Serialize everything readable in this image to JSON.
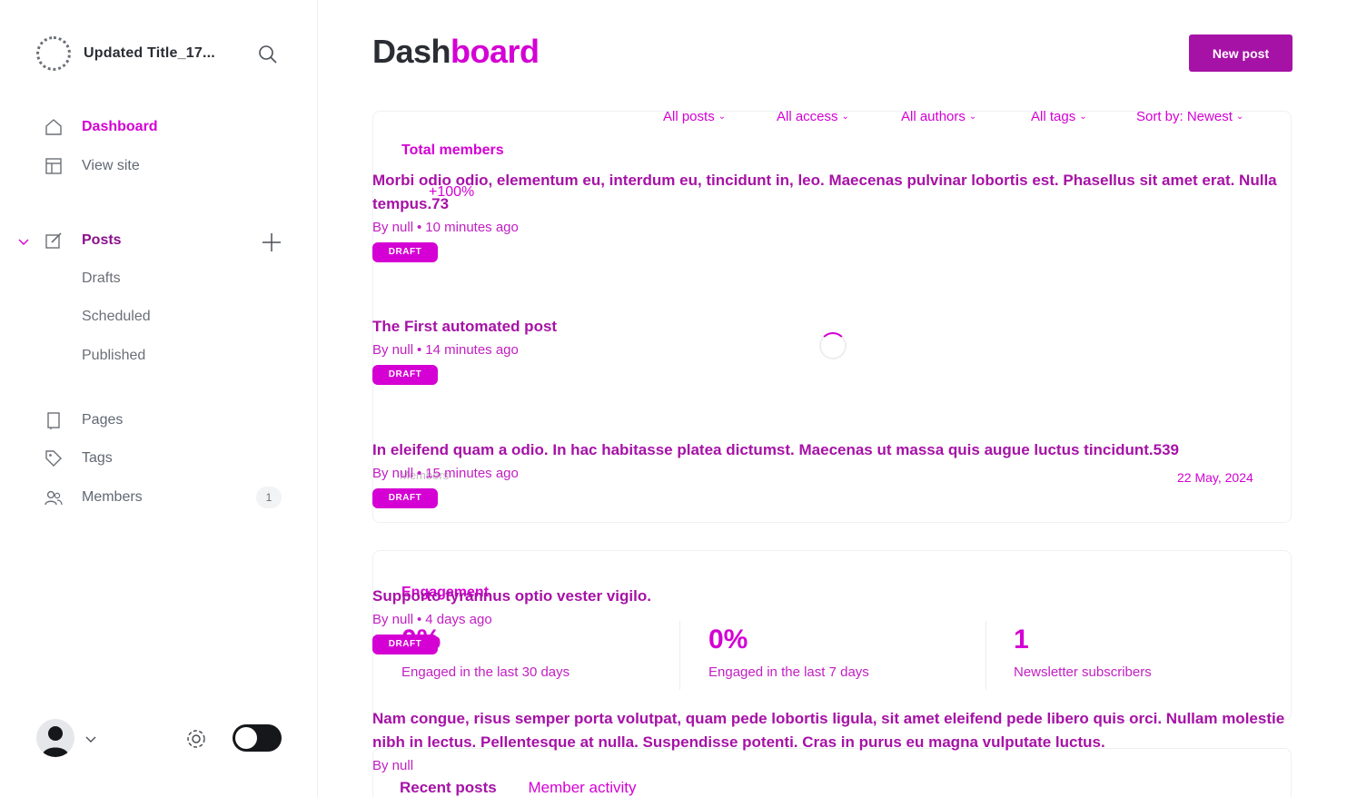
{
  "site": {
    "title": "Updated Title_17..."
  },
  "nav": {
    "dashboard": "Dashboard",
    "view_site": "View site",
    "posts": "Posts",
    "drafts": "Drafts",
    "scheduled": "Scheduled",
    "published": "Published",
    "pages": "Pages",
    "tags": "Tags",
    "members": "Members",
    "members_count": "1"
  },
  "header": {
    "title_part1": "Dash",
    "title_part2": "board",
    "new_post": "New post"
  },
  "filters": [
    {
      "label": "All posts"
    },
    {
      "label": "All access"
    },
    {
      "label": "All authors"
    },
    {
      "label": "All tags"
    },
    {
      "label": "Sort by: Newest"
    }
  ],
  "dashboard": {
    "total_members_label": "Total members",
    "growth": "+100%",
    "date": "22 May, 2024",
    "faint_label": "Members",
    "engagement_label": "Engagement",
    "stats": [
      {
        "value": "0%",
        "label": "Engaged in the last 30 days"
      },
      {
        "value": "0%",
        "label": "Engaged in the last 7 days"
      },
      {
        "value": "1",
        "label": "Newsletter subscribers"
      }
    ],
    "tab_recent_posts": "Recent posts",
    "tab_member_activity": "Member activity"
  },
  "posts": [
    {
      "title": "Morbi odio odio, elementum eu, interdum eu, tincidunt in, leo. Maecenas pulvinar lobortis est. Phasellus sit amet erat. Nulla tempus.73",
      "author": "By null",
      "time": "10 minutes ago",
      "status": "DRAFT"
    },
    {
      "title": "The First automated post",
      "author": "By null",
      "time": "14 minutes ago",
      "status": "DRAFT"
    },
    {
      "title": "In eleifend quam a odio. In hac habitasse platea dictumst. Maecenas ut massa quis augue luctus tincidunt.539",
      "author": "By null",
      "time": "15 minutes ago",
      "status": "DRAFT"
    },
    {
      "title": "Supporto tyrannus optio vester vigilo.",
      "author": "By null",
      "time": "4 days ago",
      "status": "DRAFT"
    },
    {
      "title": "Nam congue, risus semper porta volutpat, quam pede lobortis ligula, sit amet eleifend pede libero quis orci. Nullam molestie nibh in lectus. Pellentesque at nulla. Suspendisse potenti. Cras in purus eu magna vulputate luctus.",
      "author": "By null",
      "time": "",
      "status": ""
    }
  ],
  "colors": {
    "accent": "#d400d4",
    "accent_dark": "#a612a6",
    "text": "#15171a"
  }
}
